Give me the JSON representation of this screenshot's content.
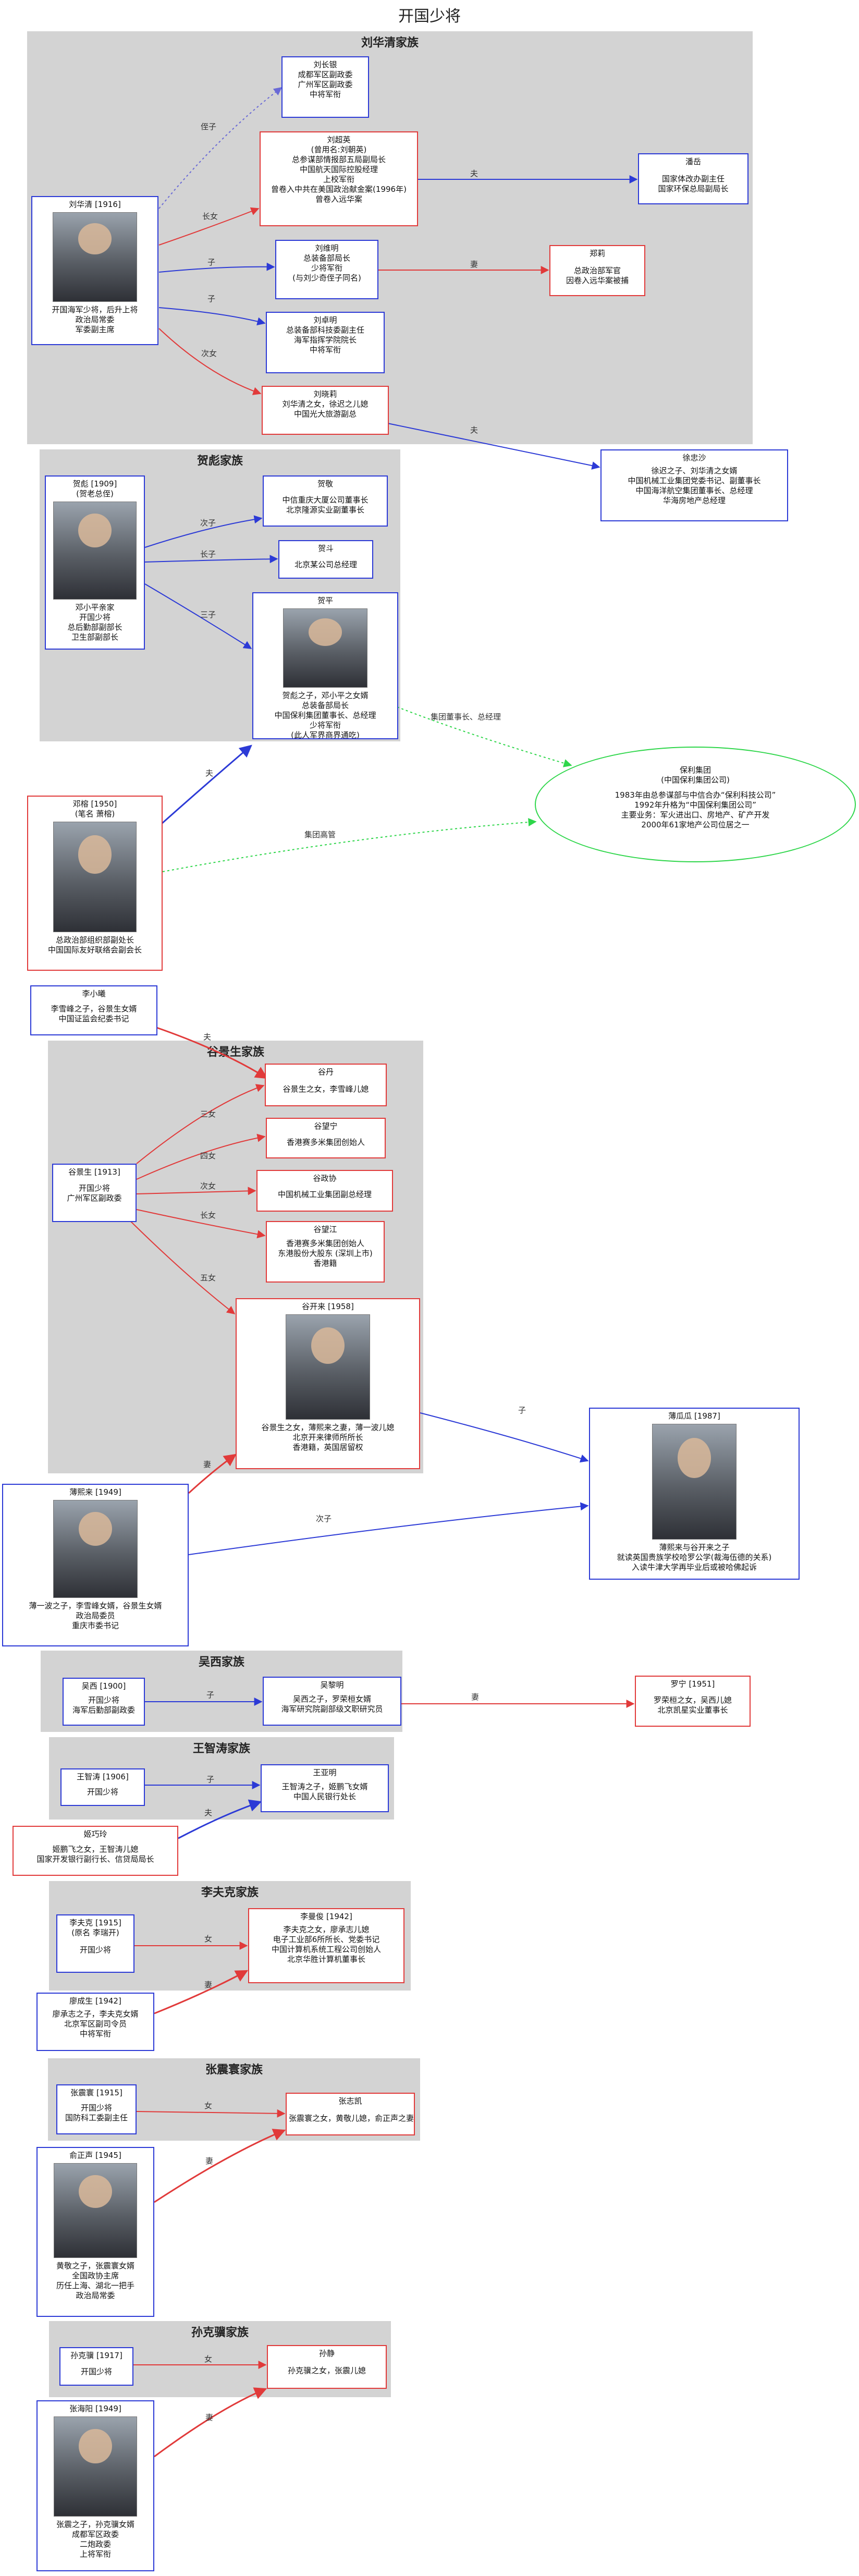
{
  "page_title": "开国少将",
  "clusters": {
    "liu": "刘华清家族",
    "he": "贺彪家族",
    "gu": "谷景生家族",
    "wu": "吴西家族",
    "wang": "王智涛家族",
    "li": "李夫克家族",
    "zhang": "张震寰家族",
    "sun": "孙克骥家族"
  },
  "nodes": {
    "liuchangyin": [
      "刘长银",
      "成都军区副政委",
      "广州军区副政委",
      "中将军衔"
    ],
    "liuchaoying": [
      "刘超英",
      "(曾用名:刘朝英)",
      "总参谋部情报部五局副局长",
      "中国航天国际控股经理",
      "上校军衔",
      "曾卷入中共在美国政治献金案(1996年)",
      "曾卷入远华案"
    ],
    "liuhuaqing": [
      "刘华清 [1916]",
      "开国海军少将，后升上将",
      "政治局常委",
      "军委副主席"
    ],
    "liuweiming": [
      "刘维明",
      "总装备部局长",
      "少将军衔",
      "(与刘少奇侄子同名)"
    ],
    "liuzhuoming": [
      "刘卓明",
      "总装备部科技委副主任",
      "海军指挥学院院长",
      "中将军衔"
    ],
    "liuxiaoli": [
      "刘晓莉",
      "刘华清之女，徐迟之儿媳",
      "中国光大旅游副总"
    ],
    "panyue": [
      "潘岳",
      "国家体改办副主任",
      "国家环保总局副局长"
    ],
    "zhengli": [
      "郑莉",
      "总政治部军官",
      "因卷入远华案被捕"
    ],
    "xuzhongsha": [
      "徐忠沙",
      "徐迟之子、刘华清之女婿",
      "中国机械工业集团党委书记、副董事长",
      "中国海洋航空集团董事长、总经理",
      "华海房地产总经理"
    ],
    "hebiao": [
      "贺彪 [1909]",
      "(贺老总侄)",
      "邓小平亲家",
      "开国少将",
      "总后勤部副部长",
      "卫生部副部长"
    ],
    "hejing": [
      "贺敬",
      "中信重庆大厦公司董事长",
      "北京隆源实业副董事长"
    ],
    "hedou": [
      "贺斗",
      "北京某公司总经理"
    ],
    "heping": [
      "贺平",
      "贺彪之子，邓小平之女婿",
      "总装备部局长",
      "中国保利集团董事长、总经理",
      "少将军衔",
      "(此人军界商界通吃)"
    ],
    "dengrong": [
      "邓榕 [1950]",
      "(笔名 萧榕)"
    ],
    "dengrong_desc": [
      "总政治部组织部副处长",
      "中国国际友好联络会副会长"
    ],
    "baoli": [
      "保利集团",
      "(中国保利集团公司)",
      "1983年由总参谋部与中信合办“保利科技公司”",
      "1992年升格为“中国保利集团公司”",
      "主要业务：军火进出口、房地产、矿产开发",
      "2000年61家地产公司位居之一"
    ],
    "lixiaoxi": [
      "李小曦",
      "李雪峰之子，谷景生女婿",
      "中国证监会纪委书记"
    ],
    "gujingsheng": [
      "谷景生 [1913]",
      "开国少将",
      "广州军区副政委"
    ],
    "gudan": [
      "谷丹",
      "谷景生之女，李雪峰儿媳"
    ],
    "guwangning": [
      "谷望宁",
      "香港赛多米集团创始人"
    ],
    "guzhengjie": [
      "谷政协",
      "中国机械工业集团副总经理"
    ],
    "guwangjiang": [
      "谷望江",
      "香港赛多米集团创始人",
      "东港股份大股东 (深圳上市)",
      "香港籍"
    ],
    "gukailai": [
      "谷开来 [1958]",
      "谷景生之女，薄熙来之妻，薄一波儿媳",
      "北京开来律师所所长",
      "香港籍，英国居留权"
    ],
    "boguagua": [
      "薄瓜瓜 [1987]",
      "薄熙来与谷开来之子",
      "就读英国贵族学校哈罗公学(裁海伍德的关系)",
      "入读牛津大学再毕业后或被哈佛起诉"
    ],
    "boxilai": [
      "薄熙来 [1949]",
      "薄一波之子，李雪峰女婿，谷景生女婿",
      "政治局委员",
      "重庆市委书记"
    ],
    "wuxi": [
      "吴西 [1900]",
      "开国少将",
      "海军后勤部副政委"
    ],
    "wuliming": [
      "吴黎明",
      "吴西之子，罗荣桓女婿",
      "海军研究院副部级文职研究员"
    ],
    "luoning": [
      "罗宁 [1951]",
      "罗荣桓之女，吴西儿媳",
      "北京凯星实业董事长"
    ],
    "wangzhitao": [
      "王智涛 [1906]",
      "开国少将"
    ],
    "wangxiaoming": [
      "王亚明",
      "王智涛之子，姬鹏飞女婿",
      "中国人民银行处长"
    ],
    "jiqiaojun": [
      "姬巧玲",
      "姬鹏飞之女，王智涛儿媳",
      "国家开发银行副行长、信贷局局长"
    ],
    "lifuke": [
      "李夫克 [1915]",
      "(原名 李瑞开)",
      "开国少将"
    ],
    "limanjun": [
      "李曼俊 [1942]",
      "李夫克之女，廖承志儿媳",
      "电子工业部6所所长、党委书记",
      "中国计算机系统工程公司创始人",
      "北京华胜计算机董事长"
    ],
    "liaochengsheng": [
      "廖成生 [1942]",
      "廖承志之子，李夫克女婿",
      "北京军区副司令员",
      "中将军衔"
    ],
    "zhangzhenhuan": [
      "张震寰 [1915]",
      "开国少将",
      "国防科工委副主任"
    ],
    "zhangzhikai": [
      "张志凯",
      "张震寰之女，黄敬儿媳，俞正声之妻"
    ],
    "yuzhengsheng": [
      "俞正声 [1945]",
      "黄敬之子，张震寰女婿",
      "全国政协主席",
      "历任上海、湖北一把手",
      "政治局常委"
    ],
    "sunkeji": [
      "孙克骥 [1917]",
      "开国少将"
    ],
    "sunjing": [
      "孙静",
      "孙克骥之女，张震儿媳"
    ],
    "zhanghaiyang": [
      "张海阳 [1949]",
      "张震之子，孙克骥女婿",
      "成都军区政委",
      "二炮政委",
      "上将军衔"
    ]
  },
  "edge_labels": {
    "nephew": "侄子",
    "eldest_daughter": "长女",
    "son": "子",
    "second_daughter": "次女",
    "husband": "夫",
    "wife": "妻",
    "second_son": "次子",
    "eldest_son": "长子",
    "third_son": "三子",
    "group_chairman": "集团董事长、总经理",
    "group_senior": "集团高管",
    "third_daughter": "三女",
    "fourth_daughter": "四女",
    "fifth_daughter": "五女",
    "daughter": "女"
  },
  "colors": {
    "blue": "#2c3ad6",
    "red": "#e13a3a",
    "green": "#2ed64a",
    "cluster_bg": "#d3d3d3"
  }
}
